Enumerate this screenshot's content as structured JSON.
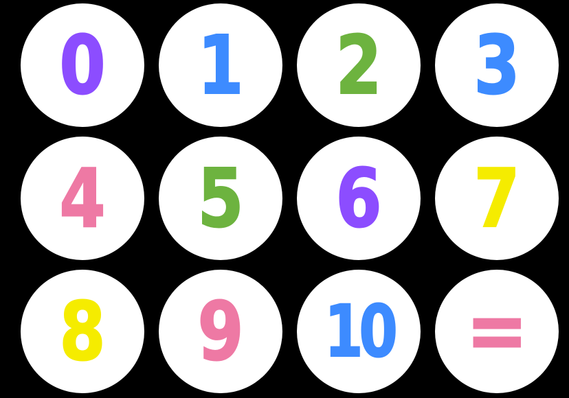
{
  "tiles": [
    {
      "label": "0",
      "color": "#8c4dff"
    },
    {
      "label": "1",
      "color": "#3d8bff"
    },
    {
      "label": "2",
      "color": "#6db33f"
    },
    {
      "label": "3",
      "color": "#3d8bff"
    },
    {
      "label": "4",
      "color": "#ee79a4"
    },
    {
      "label": "5",
      "color": "#6db33f"
    },
    {
      "label": "6",
      "color": "#8c4dff"
    },
    {
      "label": "7",
      "color": "#f5ec00"
    },
    {
      "label": "8",
      "color": "#f5ec00"
    },
    {
      "label": "9",
      "color": "#ee79a4"
    },
    {
      "label": "10",
      "color": "#3d8bff"
    },
    {
      "label": "=",
      "color": "#ee79a4"
    }
  ],
  "colors": {
    "background": "#000000",
    "tile_background": "#ffffff"
  }
}
